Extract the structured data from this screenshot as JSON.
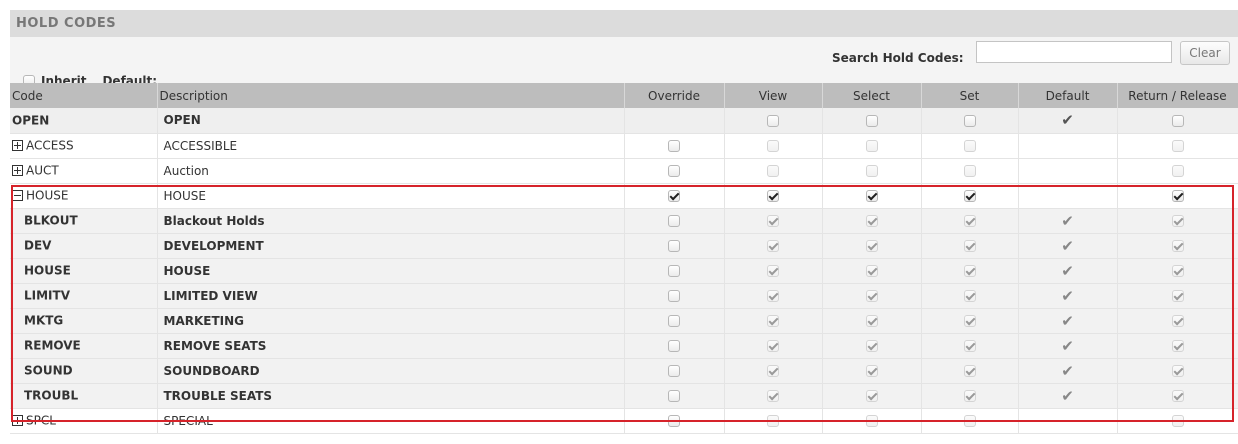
{
  "panel": {
    "title": "HOLD CODES"
  },
  "toolbar": {
    "inherit_label": "Inherit",
    "default_label": "Default:",
    "search_label": "Search Hold Codes:",
    "search_value": "",
    "clear_label": "Clear"
  },
  "columns": {
    "code": "Code",
    "description": "Description",
    "override": "Override",
    "view": "View",
    "select": "Select",
    "set": "Set",
    "default": "Default",
    "return_release": "Return / Release"
  },
  "rows": [
    {
      "code": "OPEN",
      "description": "OPEN",
      "type": "open",
      "expander": null,
      "override": null,
      "view": false,
      "select": false,
      "set": false,
      "default": true,
      "return_release": false
    },
    {
      "code": "ACCESS",
      "description": "ACCESSIBLE",
      "type": "parent",
      "expander": "plus",
      "override": false,
      "view": false,
      "select": false,
      "set": false,
      "default": null,
      "return_release": false
    },
    {
      "code": "AUCT",
      "description": "Auction",
      "type": "parent",
      "expander": "plus",
      "override": false,
      "view": false,
      "select": false,
      "set": false,
      "default": null,
      "return_release": false
    },
    {
      "code": "HOUSE",
      "description": "HOUSE",
      "type": "parent",
      "expander": "minus",
      "override": true,
      "view": true,
      "select": true,
      "set": true,
      "default": null,
      "return_release": true
    },
    {
      "code": "BLKOUT",
      "description": "Blackout Holds",
      "type": "child",
      "expander": null,
      "override": false,
      "view": true,
      "select": true,
      "set": true,
      "default": true,
      "return_release": true
    },
    {
      "code": "DEV",
      "description": "DEVELOPMENT",
      "type": "child",
      "expander": null,
      "override": false,
      "view": true,
      "select": true,
      "set": true,
      "default": true,
      "return_release": true
    },
    {
      "code": "HOUSE",
      "description": "HOUSE",
      "type": "child",
      "expander": null,
      "override": false,
      "view": true,
      "select": true,
      "set": true,
      "default": true,
      "return_release": true
    },
    {
      "code": "LIMITV",
      "description": "LIMITED VIEW",
      "type": "child",
      "expander": null,
      "override": false,
      "view": true,
      "select": true,
      "set": true,
      "default": true,
      "return_release": true
    },
    {
      "code": "MKTG",
      "description": "MARKETING",
      "type": "child",
      "expander": null,
      "override": false,
      "view": true,
      "select": true,
      "set": true,
      "default": true,
      "return_release": true
    },
    {
      "code": "REMOVE",
      "description": "REMOVE SEATS",
      "type": "child",
      "expander": null,
      "override": false,
      "view": true,
      "select": true,
      "set": true,
      "default": true,
      "return_release": true
    },
    {
      "code": "SOUND",
      "description": "SOUNDBOARD",
      "type": "child",
      "expander": null,
      "override": false,
      "view": true,
      "select": true,
      "set": true,
      "default": true,
      "return_release": true
    },
    {
      "code": "TROUBL",
      "description": "TROUBLE SEATS",
      "type": "child",
      "expander": null,
      "override": false,
      "view": true,
      "select": true,
      "set": true,
      "default": true,
      "return_release": true
    },
    {
      "code": "SPCL",
      "description": "SPECIAL",
      "type": "parent",
      "expander": "plus",
      "override": false,
      "view": false,
      "select": false,
      "set": false,
      "default": null,
      "return_release": false
    }
  ],
  "colors": {
    "highlight_border": "#d6232a",
    "header_bg": "#bdbdbd"
  }
}
